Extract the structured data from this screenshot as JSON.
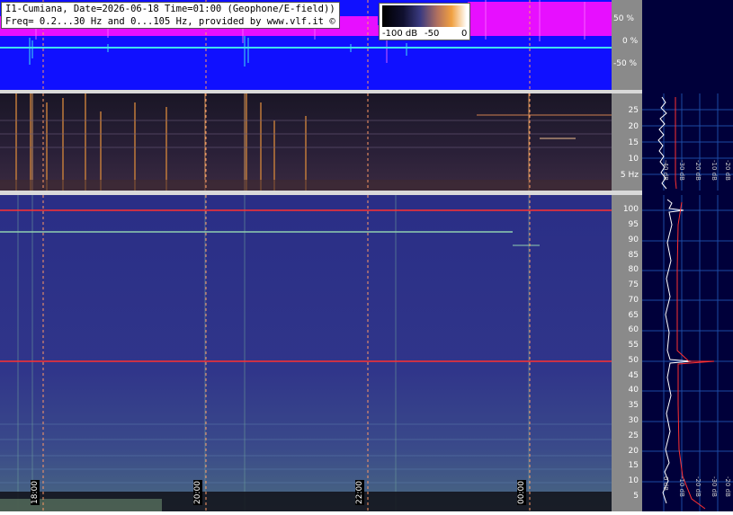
{
  "header": {
    "title_line1": "I1-Cumiana, Date=2026-06-18 Time=01:00 (Geophone/E-field))",
    "title_line2": "Freq= 0.2...30 Hz and 0...105 Hz, provided by www.vlf.it ©"
  },
  "colorbar": {
    "labels": [
      "-100 dB",
      "-50",
      "0"
    ]
  },
  "top_axis": {
    "labels": [
      "50 %",
      "0 %",
      "-50 %"
    ]
  },
  "low_freq_axis": {
    "labels": [
      "25",
      "20",
      "15",
      "10",
      "5 Hz"
    ]
  },
  "high_freq_axis": {
    "labels": [
      "100",
      "95",
      "90",
      "85",
      "80",
      "75",
      "70",
      "65",
      "60",
      "55",
      "50",
      "45",
      "40",
      "35",
      "30",
      "25",
      "20",
      "15",
      "10",
      "5"
    ]
  },
  "time_axis": {
    "labels": [
      "18:00",
      "20:00",
      "22:00",
      "00:00"
    ]
  },
  "right_panel": {
    "upper_labels": [
      "-40 dB",
      "-30 dB",
      "-20 dB",
      "-10 dB",
      "-20 dB"
    ],
    "lower_labels": [
      "0 dB",
      "-10 dB",
      "-20 dB",
      "-30 dB",
      "-40 dB",
      "-20 dB"
    ]
  },
  "colors": {
    "waveform_bg": "#1010ff",
    "waveform_env": "#ff10ff",
    "waveform_trace": "#40e0f0",
    "spectrogram_bg": "#2c2f80",
    "marker_line": "#ff3030",
    "grid": "#6fa8ff"
  }
}
